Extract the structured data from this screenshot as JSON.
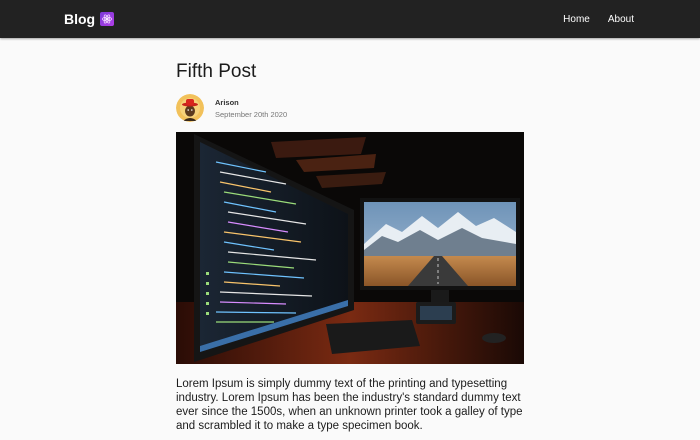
{
  "navbar": {
    "brand": "Blog",
    "links": [
      {
        "label": "Home"
      },
      {
        "label": "About"
      }
    ]
  },
  "post": {
    "title": "Fifth Post",
    "author": "Arison",
    "date": "September 20th 2020",
    "body": "Lorem Ipsum is simply dummy text of the printing and typesetting industry. Lorem Ipsum has been the industry's standard dummy text ever since the 1500s, when an unknown printer took a galley of type and scrambled it to make a type specimen book."
  },
  "colors": {
    "navbar_bg": "#222222",
    "page_bg": "#fafafa",
    "brand_logo": "#9b3ee0"
  },
  "icons": {
    "brand_logo": "atom-logo-icon",
    "avatar": "author-avatar"
  }
}
